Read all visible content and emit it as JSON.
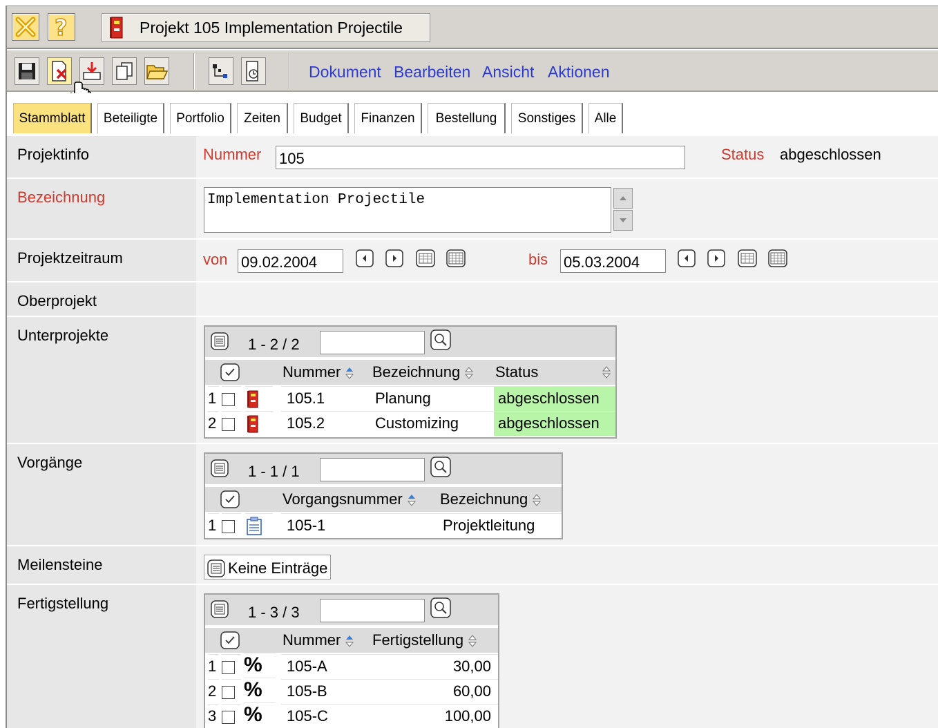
{
  "title": "Projekt 105 Implementation Projectile",
  "menu": [
    "Dokument",
    "Bearbeiten",
    "Ansicht",
    "Aktionen"
  ],
  "tabs": [
    "Stammblatt",
    "Beteiligte",
    "Portfolio",
    "Zeiten",
    "Budget",
    "Finanzen",
    "Bestellung",
    "Sonstiges",
    "Alle"
  ],
  "projektinfo": {
    "label": "Projektinfo",
    "nummer_label": "Nummer",
    "nummer_value": "105",
    "status_label": "Status",
    "status_value": "abgeschlossen"
  },
  "bezeichnung": {
    "label": "Bezeichnung",
    "value": "Implementation Projectile"
  },
  "zeitraum": {
    "label": "Projektzeitraum",
    "von_label": "von",
    "von_value": "09.02.2004",
    "bis_label": "bis",
    "bis_value": "05.03.2004"
  },
  "oberprojekt": {
    "label": "Oberprojekt"
  },
  "unterprojekte": {
    "label": "Unterprojekte",
    "range": "1 - 2 / 2",
    "columns": [
      "Nummer",
      "Bezeichnung",
      "Status"
    ],
    "rows": [
      {
        "idx": "1",
        "nummer": "105.1",
        "bezeichnung": "Planung",
        "status": "abgeschlossen"
      },
      {
        "idx": "2",
        "nummer": "105.2",
        "bezeichnung": "Customizing",
        "status": "abgeschlossen"
      }
    ]
  },
  "vorgaenge": {
    "label": "Vorgänge",
    "range": "1 - 1 / 1",
    "columns": [
      "Vorgangsnummer",
      "Bezeichnung"
    ],
    "rows": [
      {
        "idx": "1",
        "nummer": "105-1",
        "bezeichnung": "Projektleitung"
      }
    ]
  },
  "meilensteine": {
    "label": "Meilensteine",
    "empty_text": "Keine Einträge"
  },
  "fertigstellung": {
    "label": "Fertigstellung",
    "range": "1 - 3 / 3",
    "columns": [
      "Nummer",
      "Fertigstellung"
    ],
    "rows": [
      {
        "idx": "1",
        "icon": "%",
        "nummer": "105-A",
        "wert": "30,00"
      },
      {
        "idx": "2",
        "icon": "%",
        "nummer": "105-B",
        "wert": "60,00"
      },
      {
        "idx": "3",
        "icon": "%",
        "nummer": "105-C",
        "wert": "100,00"
      }
    ]
  },
  "colors": {
    "accent_red": "#cc3a2e",
    "menu_blue": "#2b3bd1",
    "tab_selected": "#fbe27e",
    "status_green": "#b8f5a8"
  }
}
